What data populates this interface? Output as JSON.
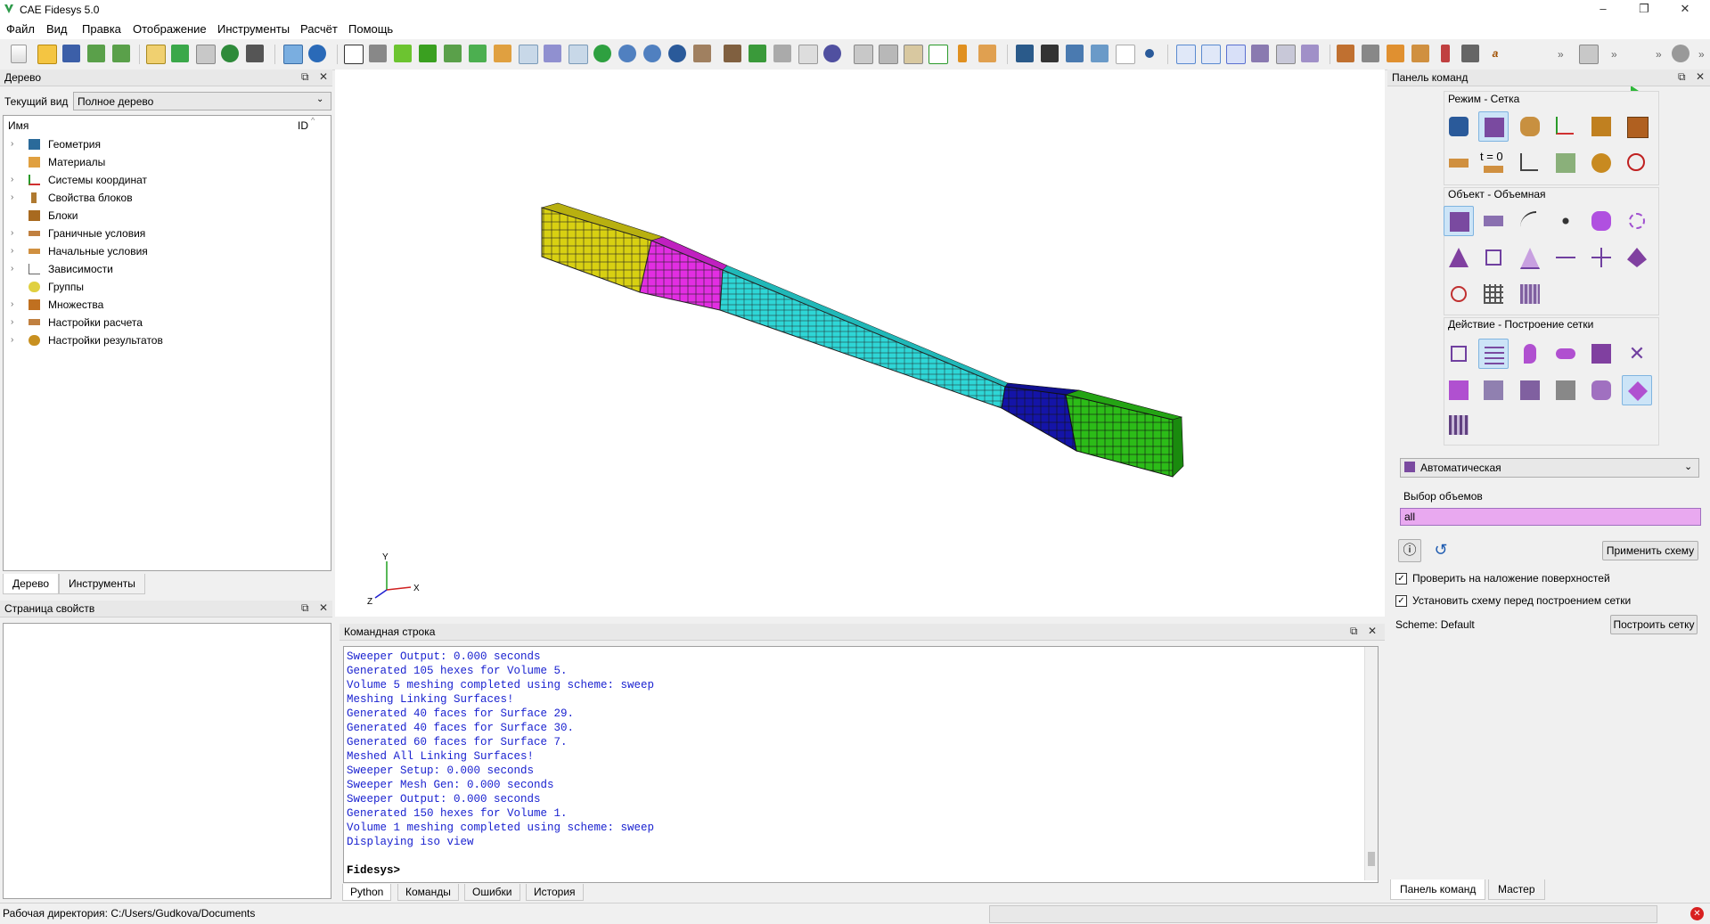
{
  "window": {
    "title": "CAE Fidesys 5.0",
    "minimize": "–",
    "restore": "❐",
    "close": "✕"
  },
  "menu": [
    "Файл",
    "Вид",
    "Правка",
    "Отображение",
    "Инструменты",
    "Расчёт",
    "Помощь"
  ],
  "tree_panel": {
    "title": "Дерево",
    "current_view_label": "Текущий вид",
    "current_view_value": "Полное дерево",
    "col_name": "Имя",
    "col_id": "ID",
    "items": [
      "Геометрия",
      "Материалы",
      "Системы координат",
      "Свойства блоков",
      "Блоки",
      "Граничные условия",
      "Начальные условия",
      "Зависимости",
      "Группы",
      "Множества",
      "Настройки расчета",
      "Настройки результатов"
    ],
    "tabs": [
      "Дерево",
      "Инструменты"
    ]
  },
  "props_panel": {
    "title": "Страница свойств"
  },
  "viewport": {
    "axis_x": "X",
    "axis_y": "Y",
    "axis_z": "Z"
  },
  "command_panel": {
    "title": "Командная строка",
    "lines": [
      "Sweeper Output: 0.000 seconds",
      "Generated 105 hexes for Volume 5.",
      "Volume 5 meshing completed using scheme: sweep",
      "Meshing Linking Surfaces!",
      "Generated 40 faces for Surface 29.",
      "Generated 40 faces for Surface 30.",
      "Generated 60 faces for Surface 7.",
      "Meshed All Linking Surfaces!",
      "Sweeper Setup: 0.000 seconds",
      "Sweeper Mesh Gen: 0.000 seconds",
      "Sweeper Output: 0.000 seconds",
      "Generated 150 hexes for Volume 1.",
      "Volume 1 meshing completed using scheme: sweep",
      "Displaying iso view"
    ],
    "prompt": "Fidesys>",
    "tabs": [
      "Python",
      "Команды",
      "Ошибки",
      "История"
    ]
  },
  "right_panel": {
    "title": "Панель команд",
    "mode_label": "Режим - Сетка",
    "object_label": "Объект - Объемная",
    "action_label": "Действие - Построение сетки",
    "scheme_select": "Автоматическая",
    "volume_select_label": "Выбор объемов",
    "volume_value": "all",
    "apply_scheme": "Применить схему",
    "check_overlap": "Проверить на наложение поверхностей",
    "set_scheme": "Установить схему перед построением сетки",
    "scheme_status": "Scheme: Default",
    "build_mesh": "Построить сетку",
    "tabs": [
      "Панель команд",
      "Мастер"
    ],
    "t0_label": "t = 0"
  },
  "statusbar": {
    "workdir": "Рабочая директория: C:/Users/Gudkova/Documents"
  },
  "colors": {
    "accent": "#0078d7",
    "selection": "#cce4f7",
    "console_text": "#1a22d0",
    "volume_field": "#e9a9f0"
  }
}
